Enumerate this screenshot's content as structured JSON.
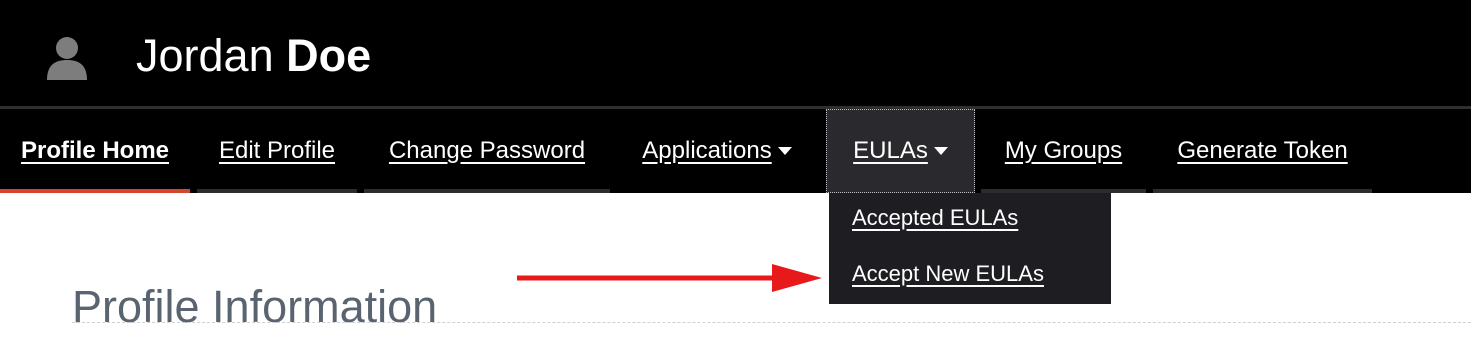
{
  "user": {
    "first_name": "Jordan",
    "last_name": "Doe",
    "avatar_icon": "user-icon"
  },
  "nav": {
    "items": [
      {
        "label": "Profile Home",
        "active": true
      },
      {
        "label": "Edit Profile"
      },
      {
        "label": "Change Password"
      },
      {
        "label": "Applications",
        "has_caret": true
      },
      {
        "label": "EULAs",
        "has_caret": true,
        "open": true
      },
      {
        "label": "My Groups"
      },
      {
        "label": "Generate Token"
      }
    ]
  },
  "dropdown": {
    "items": [
      {
        "label": "Accepted EULAs"
      },
      {
        "label": "Accept New EULAs"
      }
    ]
  },
  "main": {
    "title": "Profile Information"
  },
  "annotation": {
    "arrow_icon": "red-arrow-icon",
    "arrow_color": "#e8191a"
  },
  "colors": {
    "header_bg": "#000000",
    "active_accent": "#d8432f",
    "dropdown_bg": "#1d1d22"
  }
}
